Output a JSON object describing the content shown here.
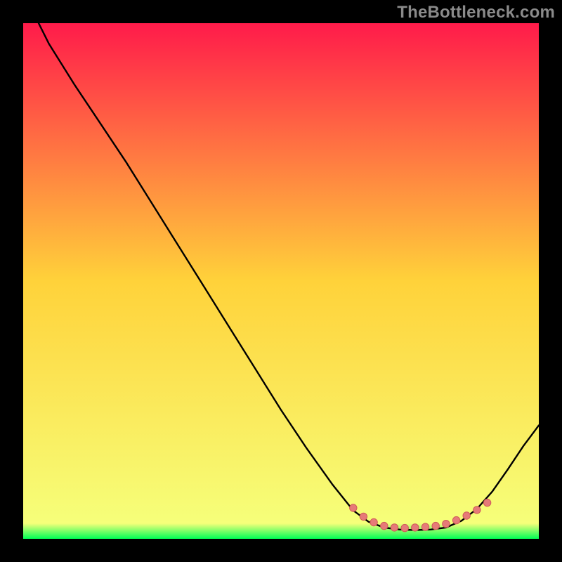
{
  "watermark": "TheBottleneck.com",
  "colors": {
    "bg": "#000000",
    "grad_top": "#ff1b4a",
    "grad_mid": "#ffd23a",
    "grad_bottom": "#00ff55",
    "curve": "#000000",
    "marker_fill": "#e67a78",
    "marker_stroke": "#cf5a58"
  },
  "chart_data": {
    "type": "line",
    "title": "",
    "xlabel": "",
    "ylabel": "",
    "xlim": [
      0,
      100
    ],
    "ylim": [
      0,
      100
    ],
    "curve": [
      {
        "x": 3,
        "y": 100
      },
      {
        "x": 5,
        "y": 96
      },
      {
        "x": 10,
        "y": 88
      },
      {
        "x": 15,
        "y": 80.5
      },
      {
        "x": 20,
        "y": 73
      },
      {
        "x": 25,
        "y": 65
      },
      {
        "x": 30,
        "y": 57
      },
      {
        "x": 35,
        "y": 49
      },
      {
        "x": 40,
        "y": 41
      },
      {
        "x": 45,
        "y": 33
      },
      {
        "x": 50,
        "y": 25
      },
      {
        "x": 55,
        "y": 17.5
      },
      {
        "x": 60,
        "y": 10.5
      },
      {
        "x": 64,
        "y": 5.5
      },
      {
        "x": 67,
        "y": 3.3
      },
      {
        "x": 70,
        "y": 2.2
      },
      {
        "x": 73,
        "y": 1.8
      },
      {
        "x": 76,
        "y": 1.7
      },
      {
        "x": 79,
        "y": 1.8
      },
      {
        "x": 82,
        "y": 2.2
      },
      {
        "x": 85,
        "y": 3.5
      },
      {
        "x": 88,
        "y": 5.8
      },
      {
        "x": 91,
        "y": 9.2
      },
      {
        "x": 94,
        "y": 13.5
      },
      {
        "x": 97,
        "y": 18
      },
      {
        "x": 100,
        "y": 22
      }
    ],
    "markers": [
      {
        "x": 64,
        "y": 6.0
      },
      {
        "x": 66,
        "y": 4.3
      },
      {
        "x": 68,
        "y": 3.2
      },
      {
        "x": 70,
        "y": 2.5
      },
      {
        "x": 72,
        "y": 2.2
      },
      {
        "x": 74,
        "y": 2.1
      },
      {
        "x": 76,
        "y": 2.2
      },
      {
        "x": 78,
        "y": 2.3
      },
      {
        "x": 80,
        "y": 2.5
      },
      {
        "x": 82,
        "y": 2.9
      },
      {
        "x": 84,
        "y": 3.6
      },
      {
        "x": 86,
        "y": 4.5
      },
      {
        "x": 88,
        "y": 5.6
      },
      {
        "x": 90,
        "y": 7.0
      }
    ]
  }
}
